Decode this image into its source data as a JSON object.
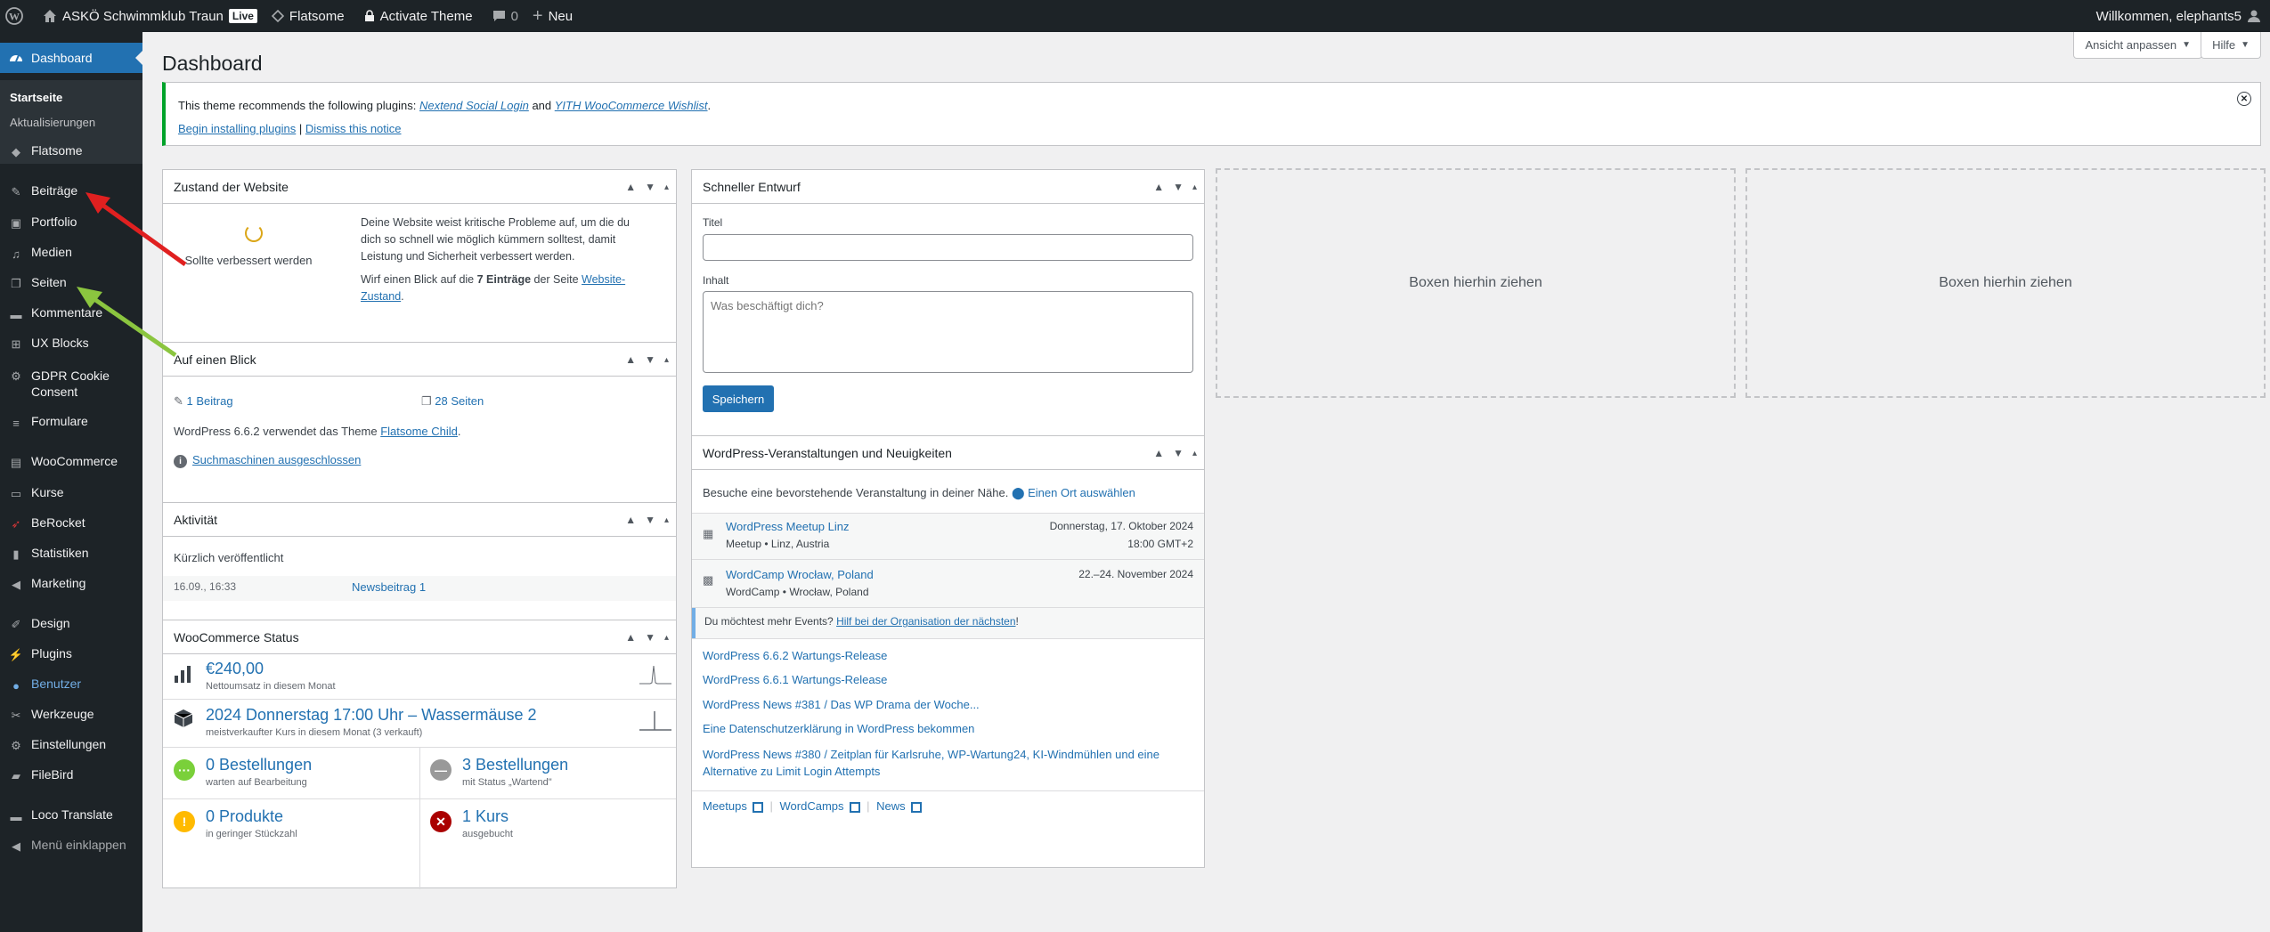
{
  "adminbar": {
    "site_name": "ASKÖ Schwimmklub Traun",
    "live": "Live",
    "flatsome": "Flatsome",
    "activate_theme": "Activate Theme",
    "comments_count": "0",
    "new": "Neu",
    "welcome": "Willkommen, elephants5"
  },
  "sidebar": {
    "items": [
      {
        "label": "Dashboard"
      },
      {
        "label": "Flatsome"
      },
      {
        "label": "Beiträge"
      },
      {
        "label": "Portfolio"
      },
      {
        "label": "Medien"
      },
      {
        "label": "Seiten"
      },
      {
        "label": "Kommentare"
      },
      {
        "label": "UX Blocks"
      },
      {
        "label": "GDPR Cookie Consent"
      },
      {
        "label": "Formulare"
      },
      {
        "label": "WooCommerce"
      },
      {
        "label": "Kurse"
      },
      {
        "label": "BeRocket"
      },
      {
        "label": "Statistiken"
      },
      {
        "label": "Marketing"
      },
      {
        "label": "Design"
      },
      {
        "label": "Plugins"
      },
      {
        "label": "Benutzer"
      },
      {
        "label": "Werkzeuge"
      },
      {
        "label": "Einstellungen"
      },
      {
        "label": "FileBird"
      },
      {
        "label": "Loco Translate"
      },
      {
        "label": "Menü einklappen"
      }
    ],
    "submenu": [
      "Startseite",
      "Aktualisierungen"
    ]
  },
  "page": {
    "title": "Dashboard",
    "screen_options": "Ansicht anpassen",
    "help": "Hilfe"
  },
  "notice": {
    "text_before": "This theme recommends the following plugins: ",
    "plugin1": "Nextend Social Login",
    "and": " and ",
    "plugin2": "YITH WooCommerce Wishlist",
    "period": ".",
    "begin": "Begin installing plugins",
    "sep": " | ",
    "dismiss": "Dismiss this notice"
  },
  "site_health": {
    "title": "Zustand der Website",
    "status": "Sollte verbessert werden",
    "text1": "Deine Website weist kritische Probleme auf, um die du dich so schnell wie möglich kümmern solltest, damit Leistung und Sicherheit verbessert werden.",
    "text2_a": "Wirf einen Blick auf die ",
    "text2_b": "7 Einträge",
    "text2_c": " der Seite ",
    "text2_link": "Website-Zustand",
    "text2_d": "."
  },
  "glance": {
    "title": "Auf einen Blick",
    "posts": "1 Beitrag",
    "pages": "28 Seiten",
    "wp_text": "WordPress 6.6.2 verwendet das Theme ",
    "theme": "Flatsome Child",
    "dot": ".",
    "search_engines": "Suchmaschinen ausgeschlossen"
  },
  "activity": {
    "title": "Aktivität",
    "recent": "Kürzlich veröffentlicht",
    "date": "16.09., 16:33",
    "post": "Newsbeitrag 1"
  },
  "woo": {
    "title": "WooCommerce Status",
    "revenue": "€240,00",
    "revenue_label": "Nettoumsatz in diesem Monat",
    "top_seller": "2024 Donnerstag 17:00 Uhr – Wassermäuse 2",
    "top_seller_label": "meistverkaufter Kurs in diesem Monat (3 verkauft)",
    "processing": "0 Bestellungen",
    "processing_label": "warten auf Bearbeitung",
    "onhold": "3 Bestellungen",
    "onhold_label": "mit Status „Wartend\"",
    "lowstock": "0 Produkte",
    "lowstock_label": "in geringer Stückzahl",
    "outofstock": "1 Kurs",
    "outofstock_label": "ausgebucht"
  },
  "draft": {
    "title": "Schneller Entwurf",
    "title_label": "Titel",
    "content_label": "Inhalt",
    "content_placeholder": "Was beschäftigt dich?",
    "save": "Speichern"
  },
  "events": {
    "title": "WordPress-Veranstaltungen und Neuigkeiten",
    "intro": "Besuche eine bevorstehende Veranstaltung in deiner Nähe.",
    "select_location": "Einen Ort auswählen",
    "list": [
      {
        "name": "WordPress Meetup Linz",
        "meta": "Meetup • Linz, Austria",
        "date": "Donnerstag, 17. Oktober 2024",
        "time": "18:00 GMT+2"
      },
      {
        "name": "WordCamp Wrocław, Poland",
        "meta": "WordCamp • Wrocław, Poland",
        "date": "22.–24. November 2024",
        "time": ""
      }
    ],
    "more_a": "Du möchtest mehr Events? ",
    "more_link": "Hilf bei der Organisation der nächsten",
    "more_b": "!",
    "news": [
      "WordPress 6.6.2 Wartungs-Release",
      "WordPress 6.6.1 Wartungs-Release",
      "WordPress News #381 / Das WP Drama der Woche...",
      "Eine Datenschutzerklärung in WordPress bekommen",
      "WordPress News #380 / Zeitplan für Karlsruhe, WP-Wartung24, KI-Windmühlen und eine Alternative zu Limit Login Attempts"
    ],
    "footer": [
      "Meetups",
      "WordCamps",
      "News"
    ]
  },
  "dropzone": "Boxen hierhin ziehen"
}
